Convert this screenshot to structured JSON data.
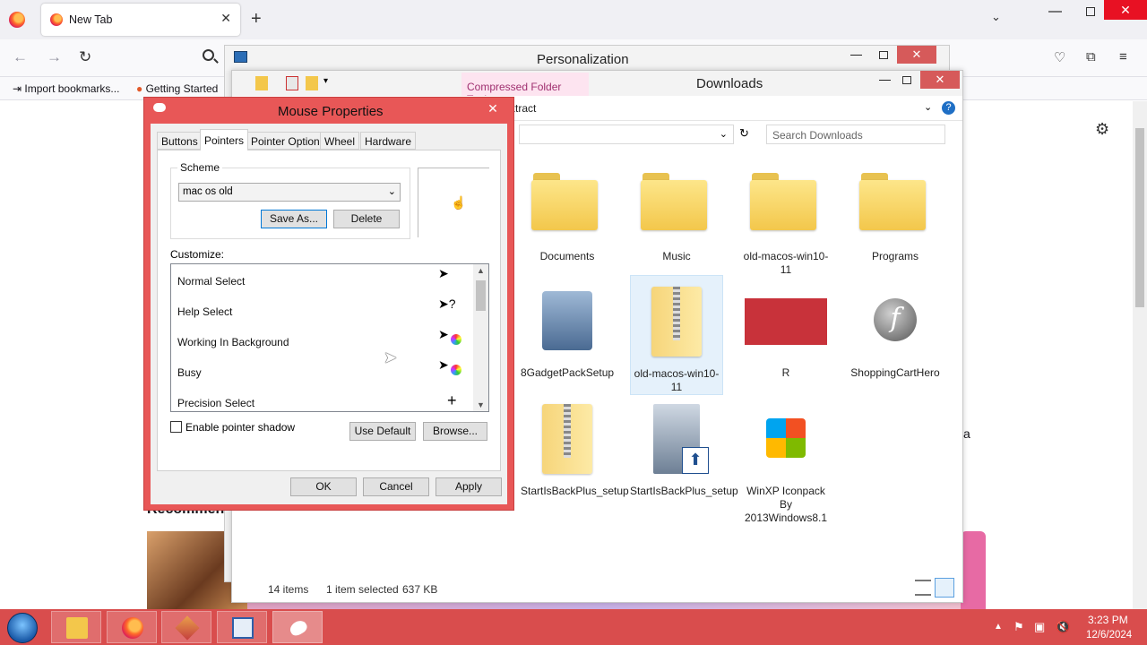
{
  "browser": {
    "tab_title": "New Tab",
    "bookmarks": [
      "Import bookmarks...",
      "Getting Started"
    ],
    "page_heading_fragment": "Recommen",
    "page_letter": "a"
  },
  "personalization": {
    "title": "Personalization"
  },
  "explorer": {
    "title": "Downloads",
    "context_tab": "Compressed Folder Tools",
    "ribbon_item": "xtract",
    "search_placeholder": "Search Downloads",
    "status": {
      "items": "14 items",
      "selected": "1 item selected",
      "size": "637 KB"
    },
    "files": [
      {
        "name": "Documents",
        "icon": "folder-icon"
      },
      {
        "name": "Music",
        "icon": "folder-icon"
      },
      {
        "name": "old-macos-win10-11",
        "icon": "folder-icon"
      },
      {
        "name": "Programs",
        "icon": "folder-icon"
      },
      {
        "name": "8GadgetPackSetup",
        "icon": "installer-icon"
      },
      {
        "name": "old-macos-win10-11",
        "icon": "zip-folder-icon",
        "selected": true
      },
      {
        "name": "R",
        "icon": "image-icon"
      },
      {
        "name": "ShoppingCartHero",
        "icon": "flash-icon"
      },
      {
        "name": "StartIsBackPlus_setup",
        "icon": "zip-folder-icon"
      },
      {
        "name": "StartIsBackPlus_setup",
        "icon": "setup-icon"
      },
      {
        "name": "WinXP Iconpack By 2013Windows8.1",
        "icon": "windows-icon"
      }
    ]
  },
  "mouse_properties": {
    "title": "Mouse Properties",
    "tabs": [
      "Buttons",
      "Pointers",
      "Pointer Options",
      "Wheel",
      "Hardware"
    ],
    "active_tab": "Pointers",
    "scheme_label": "Scheme",
    "scheme_value": "mac os old",
    "save_as": "Save As...",
    "delete": "Delete",
    "customize_label": "Customize:",
    "pointers": [
      "Normal Select",
      "Help Select",
      "Working In Background",
      "Busy",
      "Precision Select"
    ],
    "enable_shadow": "Enable pointer shadow",
    "use_default": "Use Default",
    "browse": "Browse...",
    "ok": "OK",
    "cancel": "Cancel",
    "apply": "Apply"
  },
  "taskbar": {
    "time": "3:23 PM",
    "date": "12/6/2024"
  }
}
